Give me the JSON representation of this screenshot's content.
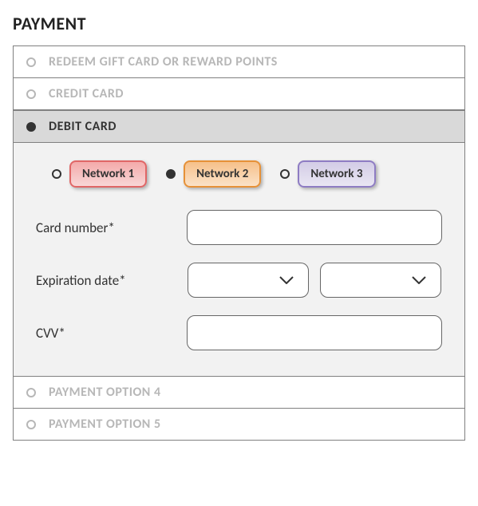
{
  "title": "PAYMENT",
  "methods": {
    "redeem": {
      "label": "REDEEM GIFT CARD OR REWARD POINTS",
      "selected": false
    },
    "credit": {
      "label": "CREDIT CARD",
      "selected": false
    },
    "debit": {
      "label": "DEBIT CARD",
      "selected": true
    },
    "opt4": {
      "label": "PAYMENT OPTION 4",
      "selected": false
    },
    "opt5": {
      "label": "PAYMENT OPTION 5",
      "selected": false
    }
  },
  "networks": {
    "n1": {
      "label": "Network 1",
      "selected": false
    },
    "n2": {
      "label": "Network 2",
      "selected": true
    },
    "n3": {
      "label": "Network 3",
      "selected": false
    }
  },
  "fields": {
    "card_number": {
      "label": "Card number*",
      "value": ""
    },
    "expiration": {
      "label": "Expiration date*",
      "month": "",
      "year": ""
    },
    "cvv": {
      "label": "CVV*",
      "value": ""
    }
  }
}
